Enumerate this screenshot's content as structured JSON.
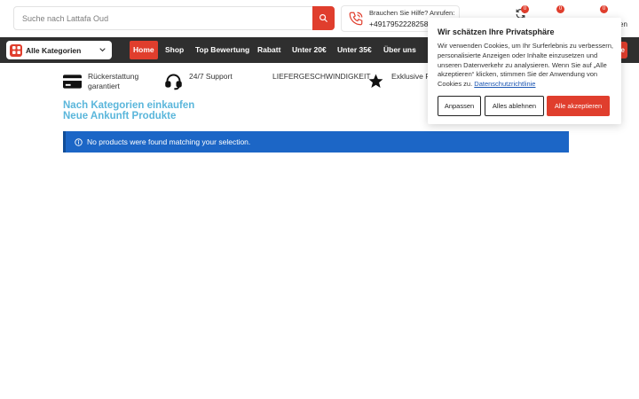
{
  "search": {
    "placeholder": "Suche nach Lattafa Oud",
    "icon": "search-icon"
  },
  "help": {
    "label": "Brauchen Sie Hilfe? Anrufen:",
    "phone": "+4917952228258"
  },
  "header_counts": {
    "compare": "0",
    "wishlist": "0",
    "cart": "0"
  },
  "header_truncated_text": "en",
  "categories": {
    "label": "Alle Kategorien"
  },
  "nav": {
    "items": [
      {
        "label": "Home"
      },
      {
        "label": "Shop"
      },
      {
        "label": "Top Bewertung"
      },
      {
        "label": "Rabatt"
      },
      {
        "label": "Unter 20€"
      },
      {
        "label": "Unter 35€"
      },
      {
        "label": "Über uns"
      }
    ],
    "active": "Home",
    "right_button_fragment": "e"
  },
  "features": {
    "refund_line1": "Rückerstattung",
    "refund_line2": "garantiert",
    "support": "24/7 Support",
    "speed": "LIEFERGESCHWINDIGKEIT",
    "exclusive": "Exklusive P"
  },
  "headings": {
    "categories": "Nach Kategorien einkaufen",
    "new_arrivals": "Neue Ankunft Produkte"
  },
  "notice": {
    "text": "No products were found matching your selection."
  },
  "cookie": {
    "title": "Wir schätzen Ihre Privatsphäre",
    "body": "Wir verwenden Cookies, um Ihr Surferlebnis zu verbessern, personalisierte Anzeigen oder Inhalte einzusetzen und unseren Datenverkehr zu analysieren. Wenn Sie auf „Alle akzeptieren“ klicken, stimmen Sie der Anwendung von Cookies zu.",
    "link": "Datenschutzrichtlinie",
    "customize": "Anpassen",
    "reject": "Alles ablehnen",
    "accept": "Alle akzeptieren"
  },
  "colors": {
    "accent": "#e03e2d",
    "nav_bg": "#2f2f2f",
    "notice_bg": "#1c66c6",
    "heading": "#5ab6db"
  }
}
